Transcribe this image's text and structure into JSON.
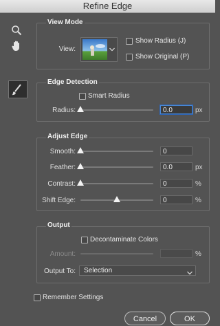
{
  "window": {
    "title": "Refine Edge"
  },
  "tools": {
    "zoom_icon": "zoom-icon",
    "hand_icon": "hand-icon",
    "brush_icon": "refine-radius-brush-icon"
  },
  "view_mode": {
    "title": "View Mode",
    "view_label": "View:",
    "show_radius": {
      "label": "Show Radius (J)",
      "checked": false
    },
    "show_original": {
      "label": "Show Original (P)",
      "checked": false
    }
  },
  "edge_detection": {
    "title": "Edge Detection",
    "smart_radius": {
      "label": "Smart Radius",
      "checked": false
    },
    "radius": {
      "label": "Radius:",
      "value": "0.0",
      "unit": "px",
      "level": 0
    }
  },
  "adjust_edge": {
    "title": "Adjust Edge",
    "smooth": {
      "label": "Smooth:",
      "value": "0",
      "unit": "",
      "level": 0
    },
    "feather": {
      "label": "Feather:",
      "value": "0.0",
      "unit": "px",
      "level": 0
    },
    "contrast": {
      "label": "Contrast:",
      "value": "0",
      "unit": "%",
      "level": 0
    },
    "shift_edge": {
      "label": "Shift Edge:",
      "value": "0",
      "unit": "%",
      "level": 0.5
    }
  },
  "output": {
    "title": "Output",
    "decontaminate": {
      "label": "Decontaminate Colors",
      "checked": false
    },
    "amount": {
      "label": "Amount:",
      "value": "",
      "unit": "%"
    },
    "output_to": {
      "label": "Output To:",
      "selected": "Selection"
    }
  },
  "remember": {
    "label": "Remember Settings",
    "checked": false
  },
  "buttons": {
    "cancel": "Cancel",
    "ok": "OK"
  }
}
